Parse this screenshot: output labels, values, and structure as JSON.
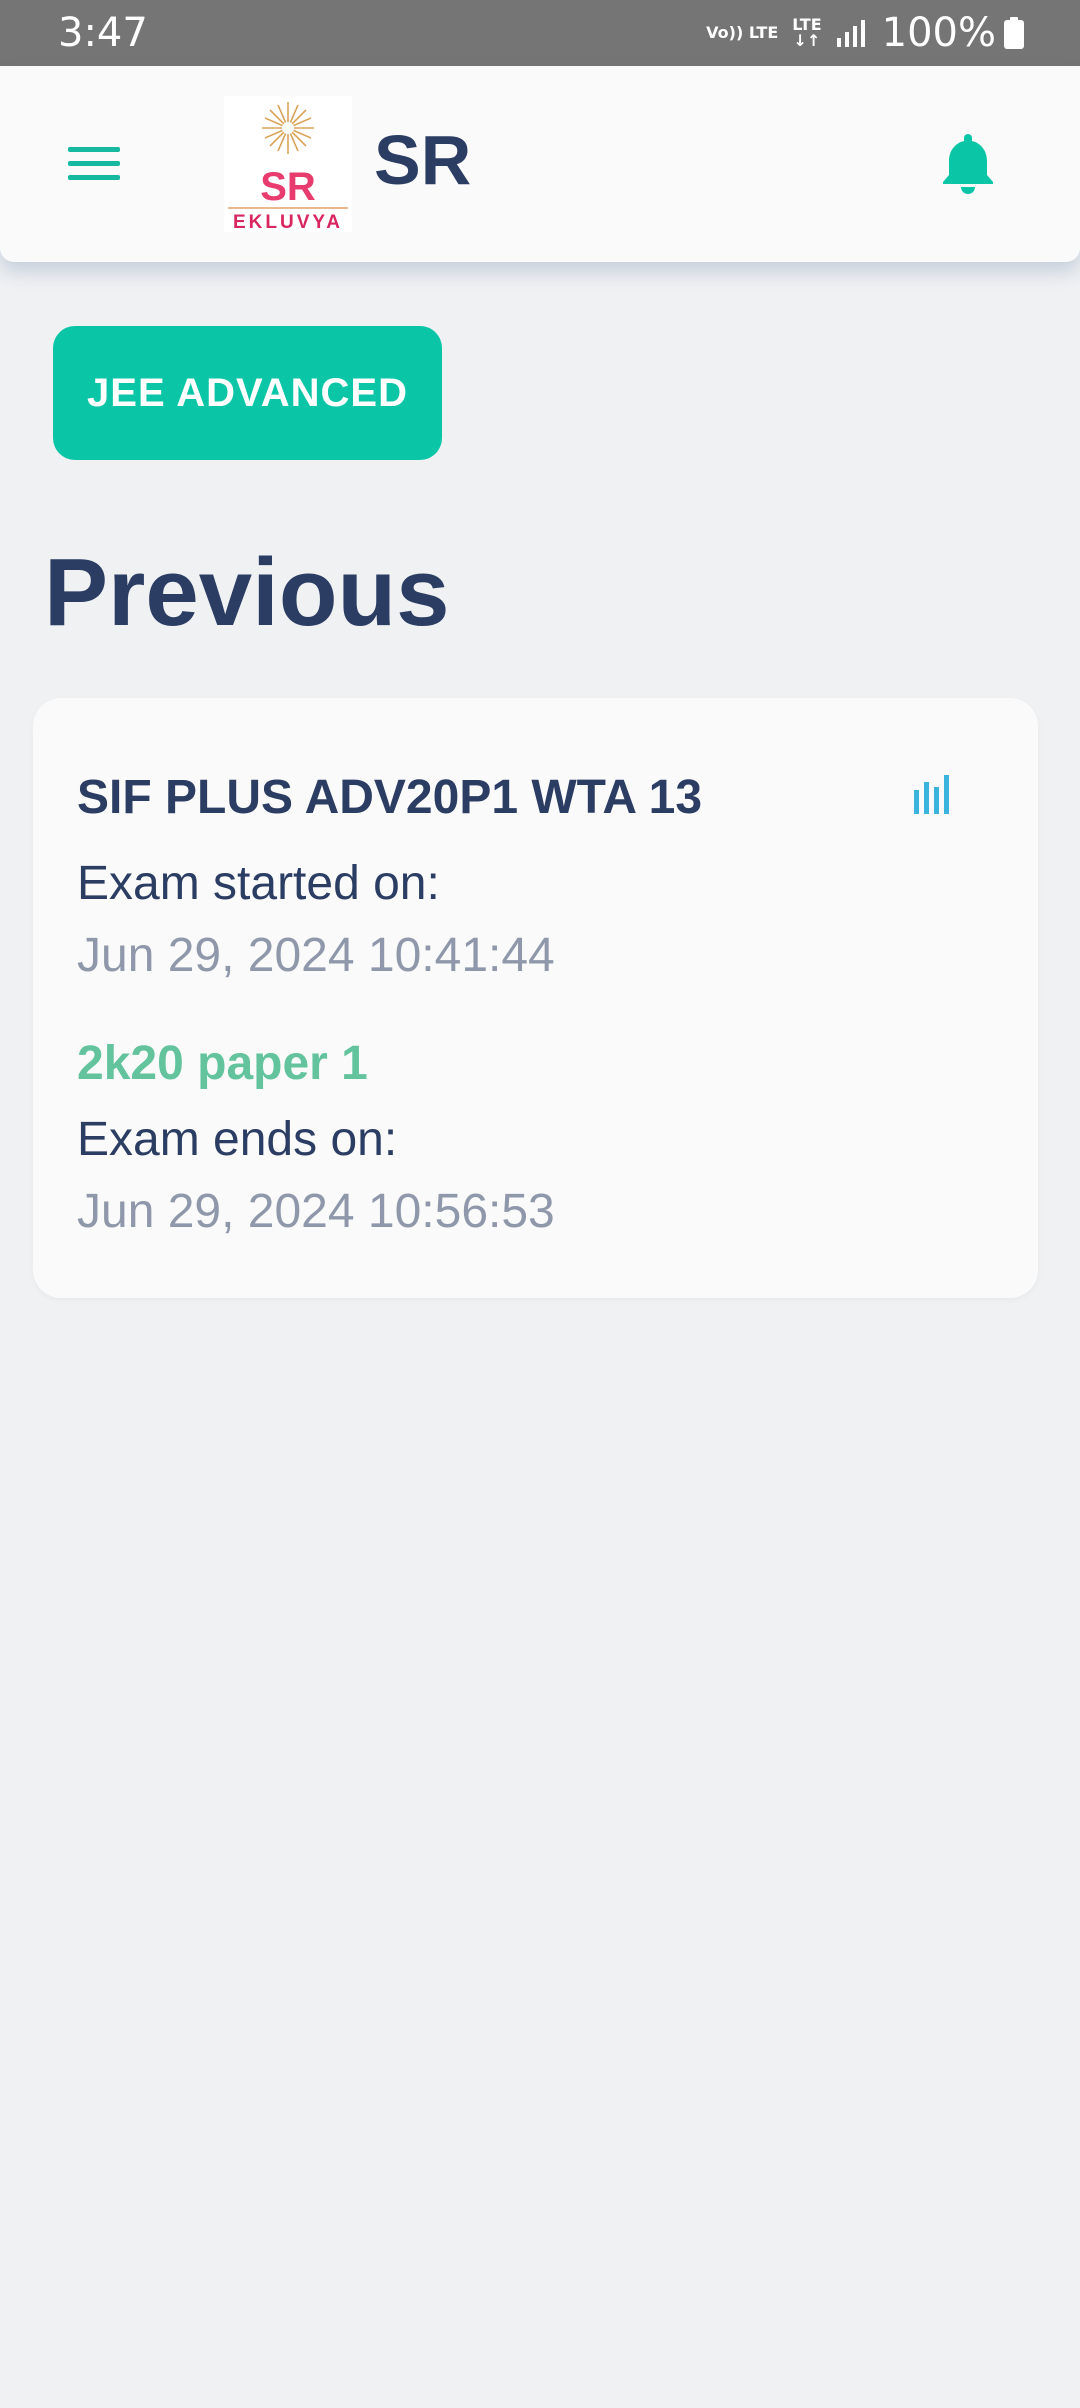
{
  "status_bar": {
    "time": "3:47",
    "network_top": "Vo)) LTE",
    "network_bottom": "LTE",
    "battery": "100%"
  },
  "app_bar": {
    "title": "SR",
    "logo": {
      "initials": "SR",
      "brand": "EKLUVYA"
    }
  },
  "chip": {
    "label": "JEE ADVANCED"
  },
  "section": {
    "title": "Previous"
  },
  "exam_card": {
    "title": "SIF PLUS ADV20P1 WTA 13",
    "started_label": "Exam started on:",
    "started_value": "Jun 29, 2024 10:41:44",
    "paper_name": "2k20 paper 1",
    "ends_label": "Exam ends on:",
    "ends_value": "Jun 29, 2024 10:56:53"
  },
  "colors": {
    "primary": "#2b3d63",
    "accent": "#0bc6a6",
    "paper_green": "#62c39d",
    "muted": "#8e98aa",
    "stats_blue": "#3ab4dc"
  },
  "icons": {
    "menu": "hamburger-icon",
    "bell": "bell-icon",
    "stats": "bar-chart-icon",
    "signal": "signal-icon",
    "battery": "battery-icon"
  }
}
